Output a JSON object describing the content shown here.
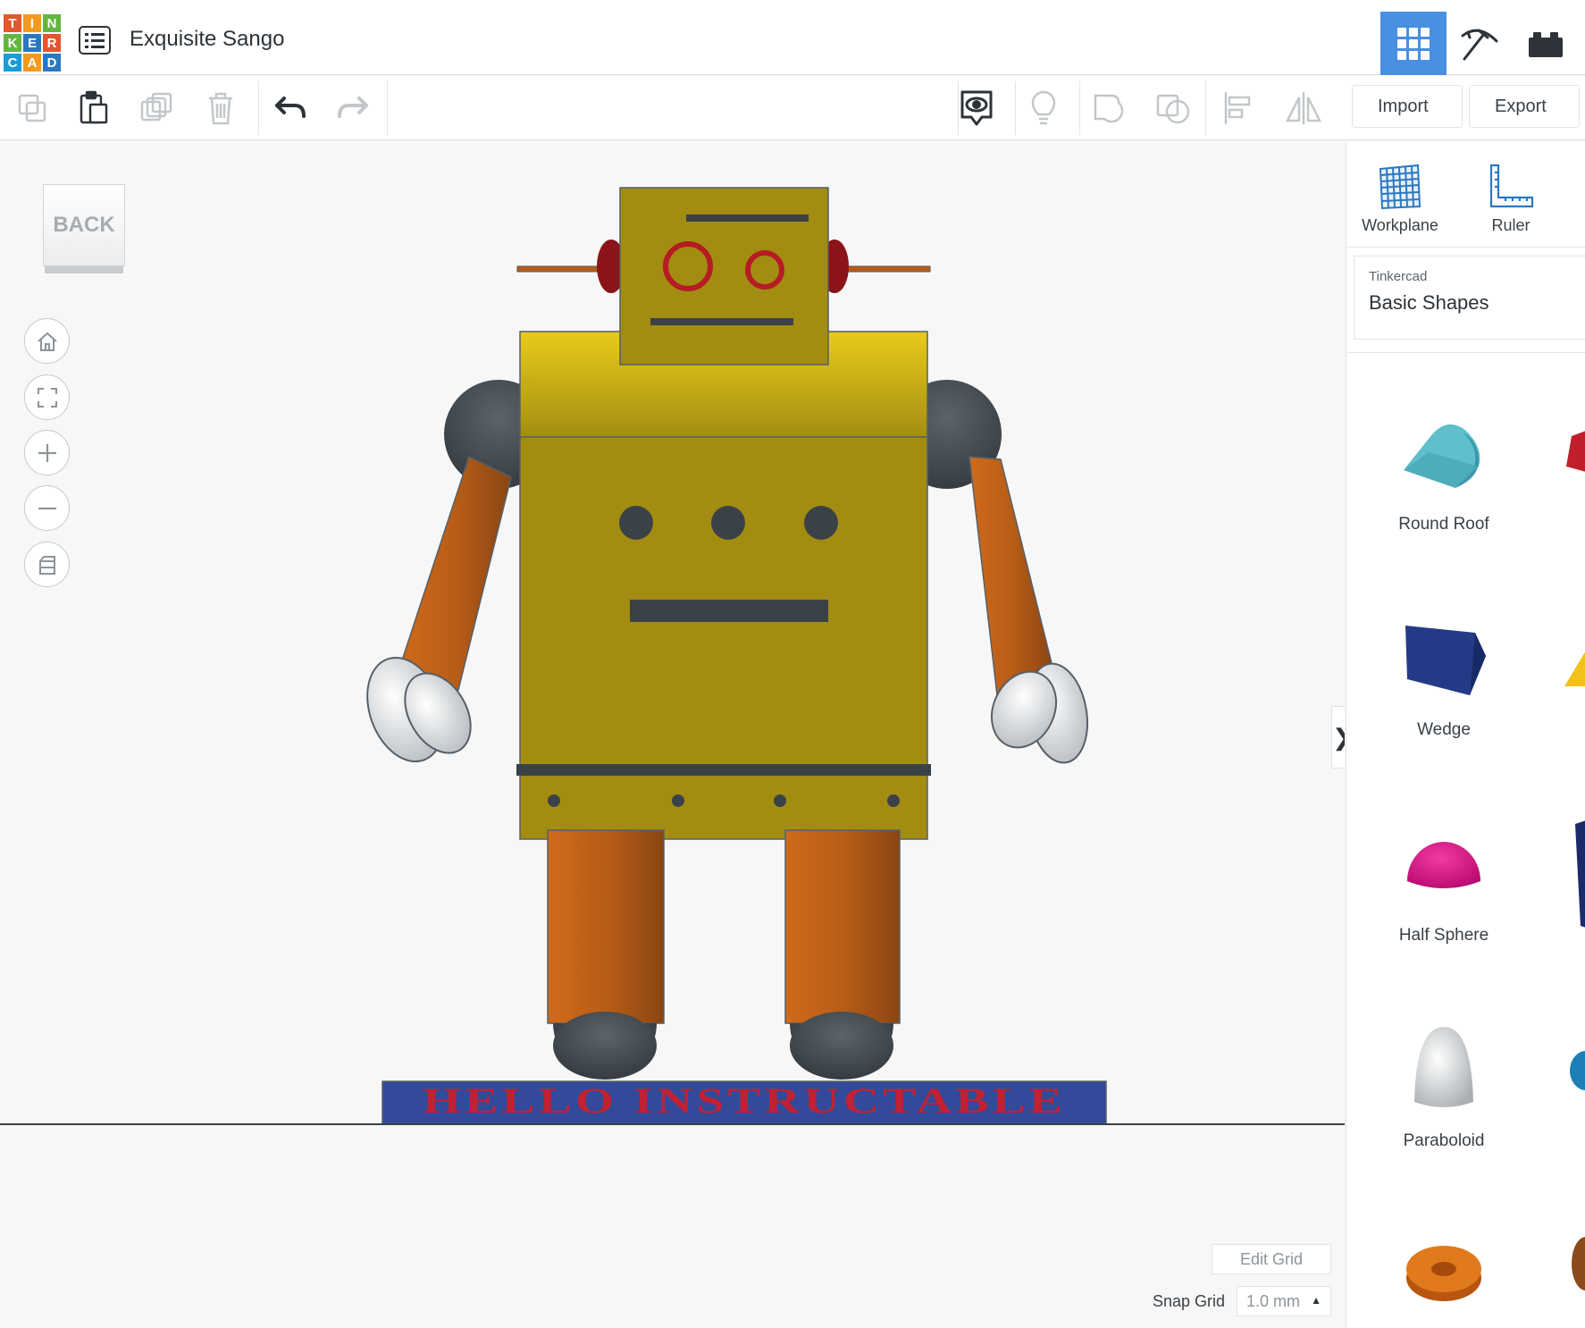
{
  "app": {
    "logo_letters": [
      "T",
      "I",
      "N",
      "K",
      "E",
      "R",
      "C",
      "A",
      "D"
    ],
    "design_title": "Exquisite Sango"
  },
  "view_modes": [
    {
      "name": "3d-design",
      "icon": "grid-icon",
      "active": true
    },
    {
      "name": "blocks",
      "icon": "pickaxe-icon",
      "active": false
    },
    {
      "name": "bricks",
      "icon": "brick-icon",
      "active": false
    }
  ],
  "toolbar": {
    "left_icons": [
      "copy-icon",
      "paste-icon",
      "duplicate-icon",
      "delete-icon",
      "undo-icon",
      "redo-icon"
    ],
    "right_icons": [
      "show-notes-icon",
      "light-bulb-icon",
      "group-icon",
      "ungroup-icon",
      "align-icon",
      "mirror-icon"
    ],
    "import_label": "Import",
    "export_label": "Export"
  },
  "canvas": {
    "back_label": "BACK",
    "nav_buttons": [
      "home-icon",
      "fit-view-icon",
      "zoom-in-icon",
      "zoom-out-icon",
      "perspective-icon"
    ],
    "robot_plate_text": "HELLO INSTRUCTABLE",
    "edit_grid_label": "Edit Grid",
    "snap_grid_label": "Snap Grid",
    "snap_grid_value": "1.0 mm",
    "panel_toggle_glyph": "❯"
  },
  "right_panel": {
    "tools": [
      {
        "label": "Workplane",
        "icon": "workplane-icon"
      },
      {
        "label": "Ruler",
        "icon": "ruler-icon"
      }
    ],
    "library": {
      "category": "Tinkercad",
      "name": "Basic Shapes"
    },
    "shapes": [
      {
        "label": "Round Roof",
        "icon": "round-roof-icon"
      },
      {
        "label": "Wedge",
        "icon": "wedge-icon"
      },
      {
        "label": "Half Sphere",
        "icon": "half-sphere-icon"
      },
      {
        "label": "Paraboloid",
        "icon": "paraboloid-icon"
      },
      {
        "label": "",
        "icon": "torus-icon"
      }
    ]
  },
  "colors": {
    "accent": "#4a90e2",
    "robot_body": "#a38c12",
    "robot_limbs": "#b85d17",
    "robot_joints": "#3b4247",
    "plate": "#33499a",
    "plate_text": "#c02233"
  }
}
